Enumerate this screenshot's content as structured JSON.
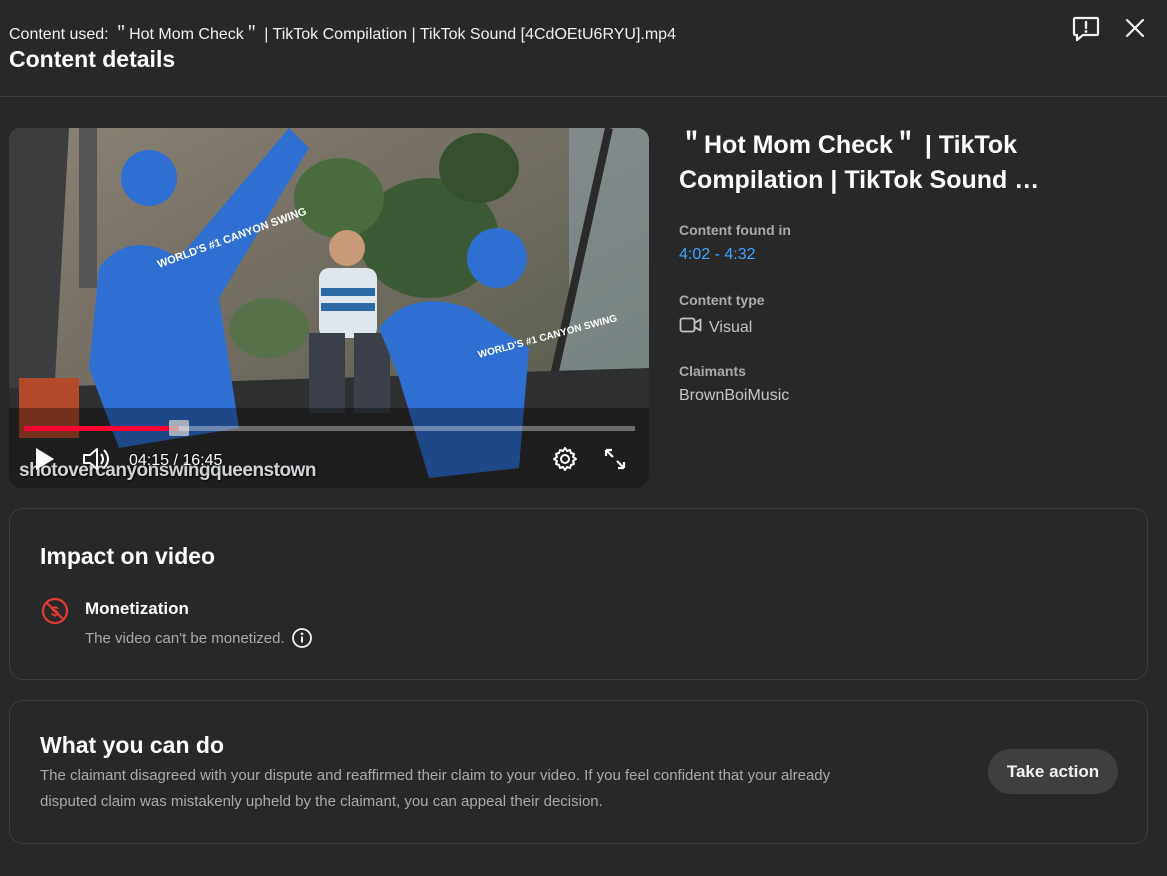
{
  "header": {
    "content_used_label": "Content used:",
    "content_used_value": "＂Hot Mom Check＂ | TikTok Compilation | TikTok Sound [4CdOEtU6RYU].mp4",
    "title": "Content details"
  },
  "player": {
    "current_time": "04:15",
    "duration": "16:45",
    "time_display": "04:15 / 16:45",
    "progress_fraction": 0.253,
    "buffer_fraction": 0.27,
    "watermark": "shotovercanyonswingqueenstown",
    "jersey_text": "WORLD'S #1 CANYON SWING"
  },
  "details": {
    "video_title": "＂Hot Mom Check＂ | TikTok Compilation | TikTok Sound …",
    "content_found_label": "Content found in",
    "content_found_value": "4:02 - 4:32",
    "content_type_label": "Content type",
    "content_type_value": "Visual",
    "claimants_label": "Claimants",
    "claimants_value": "BrownBoiMusic"
  },
  "impact": {
    "title": "Impact on video",
    "monetization_title": "Monetization",
    "monetization_desc": "The video can't be monetized."
  },
  "actions": {
    "title": "What you can do",
    "description": "The claimant disagreed with your dispute and reaffirmed their claim to your video. If you feel confident that your already disputed claim was mistakenly upheld by the claimant, you can appeal their decision.",
    "button_label": "Take action"
  },
  "colors": {
    "background": "#282828",
    "progress": "#ff0033",
    "link": "#3ea6ff",
    "alert": "#e53935"
  },
  "icons": [
    "feedback-icon",
    "close-icon",
    "play-icon",
    "volume-icon",
    "settings-icon",
    "fullscreen-icon",
    "video-camera-icon",
    "no-monetization-icon",
    "info-icon"
  ]
}
